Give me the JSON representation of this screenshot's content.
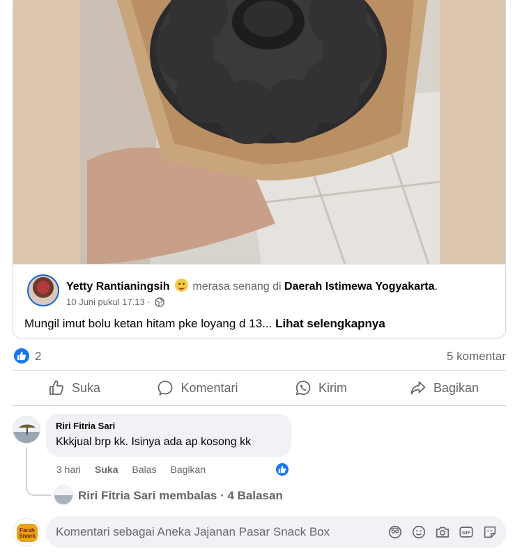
{
  "shared_post": {
    "author": "Yetty Rantianingsih",
    "feeling_text": "merasa senang di",
    "location": "Daerah Istimewa Yogyakarta",
    "period": ".",
    "timestamp": "10 Juni pukul 17.13",
    "separator": "·",
    "text": "Mungil imut bolu ketan hitam pke loyang d 13...",
    "see_more": "Lihat selengkapnya",
    "photo_subject": "chocolate bundt cake in kraft paper box"
  },
  "reactions": {
    "like_count": "2",
    "comment_count": "5 komentar"
  },
  "actions": {
    "like": "Suka",
    "comment": "Komentari",
    "send": "Kirim",
    "share": "Bagikan"
  },
  "comment": {
    "author": "Riri Fitria Sari",
    "text": "Kkkjual brp kk. Isinya ada ap kosong kk",
    "time": "3 hari",
    "like": "Suka",
    "reply": "Balas",
    "share": "Bagikan",
    "replies_link": "Riri Fitria Sari membalas · 4 Balasan"
  },
  "composer": {
    "placeholder": "Komentari sebagai Aneka Jajanan Pasar Snack Box",
    "avatar_logo_text": "Farah Snack"
  },
  "colors": {
    "accent": "#1877f2",
    "muted_text": "#65676b",
    "bubble_bg": "#f0f2f5"
  },
  "icons": [
    "like-icon",
    "comment-icon",
    "whatsapp-icon",
    "share-icon",
    "globe-icon",
    "avatar-icon",
    "sticker-icon",
    "emoji-icon",
    "camera-icon",
    "gif-icon",
    "sticker-pack-icon"
  ]
}
